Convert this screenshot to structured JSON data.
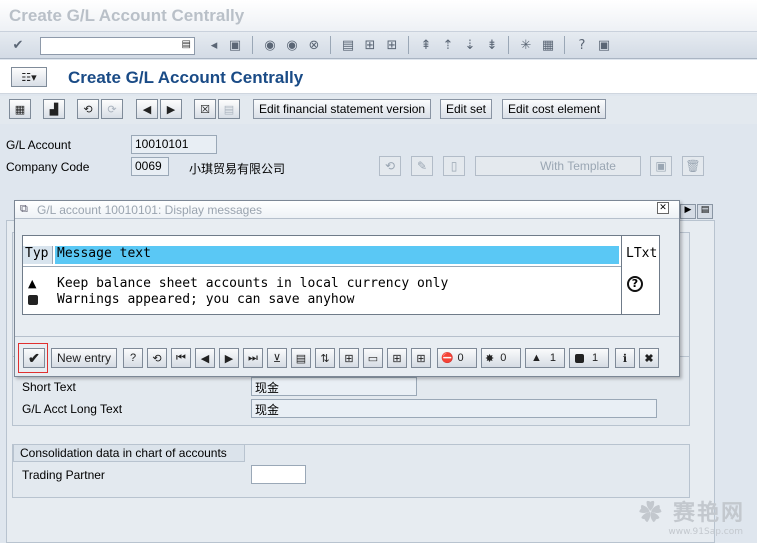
{
  "window": {
    "title": "Create G/L Account Centrally"
  },
  "page": {
    "title": "Create G/L Account Centrally"
  },
  "app_toolbar": {
    "fs_version": "Edit financial statement version",
    "edit_set": "Edit set",
    "edit_cost_element": "Edit cost element"
  },
  "header": {
    "gl_account_label": "G/L Account",
    "gl_account_value": "10010101",
    "company_code_label": "Company Code",
    "company_code_value": "0069",
    "company_name": "小琪贸易有限公司",
    "with_template": "With Template"
  },
  "dialog": {
    "title": "G/L account 10010101: Display messages",
    "columns": {
      "type": "Typ",
      "text": "Message text",
      "ltxt": "LTxt"
    },
    "messages": [
      {
        "type_icon": "warning-triangle-icon",
        "text": "Keep balance sheet accounts in local currency only"
      },
      {
        "type_icon": "info-square-icon",
        "text": "Warnings appeared; you can save anyhow"
      }
    ],
    "toolbar": {
      "new_entry": "New entry",
      "count_stop": "0",
      "count_error": "0",
      "count_warning": "1",
      "count_info": "1"
    }
  },
  "texts": {
    "short_text_label": "Short Text",
    "short_text_value": "现金",
    "long_text_label": "G/L Acct Long Text",
    "long_text_value": "现金"
  },
  "consolidation": {
    "header": "Consolidation data in chart of accounts",
    "trading_partner_label": "Trading Partner",
    "trading_partner_value": ""
  },
  "watermark": {
    "brand": "赛艳网",
    "url": "www.91Sap.com"
  },
  "colors": {
    "title_blue": "#1a4b86",
    "highlight": "#5ac8f5",
    "selected_red": "#e03030"
  }
}
